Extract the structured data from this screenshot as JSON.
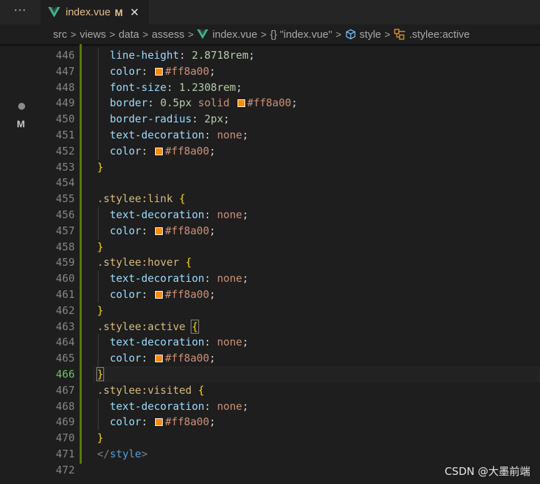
{
  "tabbar": {
    "more_label": "···",
    "tab": {
      "title": "index.vue",
      "badge": "M",
      "close": "✕"
    }
  },
  "breadcrumb": {
    "items": [
      "src",
      "views",
      "data",
      "assess",
      "index.vue",
      "{}",
      "\"index.vue\"",
      "style",
      ".stylee:active"
    ]
  },
  "gutter": {
    "modified_badge": "M"
  },
  "editor": {
    "current_line": 466,
    "lines": [
      {
        "num": "446",
        "code": [
          [
            "  ",
            "t-punc"
          ],
          [
            "line-height",
            "t-prop"
          ],
          [
            ": ",
            "t-punc"
          ],
          [
            "2.8718rem",
            "t-num"
          ],
          [
            ";",
            "t-punc"
          ]
        ]
      },
      {
        "num": "447",
        "code": [
          [
            "  ",
            "t-punc"
          ],
          [
            "color",
            "t-prop"
          ],
          [
            ": ",
            "t-punc"
          ],
          [
            "#swatch",
            "swatch"
          ],
          [
            "#ff8a00",
            "t-val"
          ],
          [
            ";",
            "t-punc"
          ]
        ]
      },
      {
        "num": "448",
        "code": [
          [
            "  ",
            "t-punc"
          ],
          [
            "font-size",
            "t-prop"
          ],
          [
            ": ",
            "t-punc"
          ],
          [
            "1.2308rem",
            "t-num"
          ],
          [
            ";",
            "t-punc"
          ]
        ]
      },
      {
        "num": "449",
        "code": [
          [
            "  ",
            "t-punc"
          ],
          [
            "border",
            "t-prop"
          ],
          [
            ": ",
            "t-punc"
          ],
          [
            "0.5px",
            "t-num"
          ],
          [
            " ",
            "t-punc"
          ],
          [
            "solid",
            "t-val"
          ],
          [
            " ",
            "t-punc"
          ],
          [
            "#swatch",
            "swatch"
          ],
          [
            "#ff8a00",
            "t-val"
          ],
          [
            ";",
            "t-punc"
          ]
        ]
      },
      {
        "num": "450",
        "code": [
          [
            "  ",
            "t-punc"
          ],
          [
            "border-radius",
            "t-prop"
          ],
          [
            ": ",
            "t-punc"
          ],
          [
            "2px",
            "t-num"
          ],
          [
            ";",
            "t-punc"
          ]
        ]
      },
      {
        "num": "451",
        "code": [
          [
            "  ",
            "t-punc"
          ],
          [
            "text-decoration",
            "t-prop"
          ],
          [
            ": ",
            "t-punc"
          ],
          [
            "none",
            "t-val"
          ],
          [
            ";",
            "t-punc"
          ]
        ]
      },
      {
        "num": "452",
        "code": [
          [
            "  ",
            "t-punc"
          ],
          [
            "color",
            "t-prop"
          ],
          [
            ": ",
            "t-punc"
          ],
          [
            "#swatch",
            "swatch"
          ],
          [
            "#ff8a00",
            "t-val"
          ],
          [
            ";",
            "t-punc"
          ]
        ]
      },
      {
        "num": "453",
        "code": [
          [
            "}",
            "t-brace"
          ]
        ]
      },
      {
        "num": "454",
        "code": []
      },
      {
        "num": "455",
        "code": [
          [
            ".stylee:link",
            "t-sel"
          ],
          [
            " ",
            "t-punc"
          ],
          [
            "{",
            "t-brace"
          ]
        ]
      },
      {
        "num": "456",
        "code": [
          [
            "  ",
            "t-punc"
          ],
          [
            "text-decoration",
            "t-prop"
          ],
          [
            ": ",
            "t-punc"
          ],
          [
            "none",
            "t-val"
          ],
          [
            ";",
            "t-punc"
          ]
        ]
      },
      {
        "num": "457",
        "code": [
          [
            "  ",
            "t-punc"
          ],
          [
            "color",
            "t-prop"
          ],
          [
            ": ",
            "t-punc"
          ],
          [
            "#swatch",
            "swatch"
          ],
          [
            "#ff8a00",
            "t-val"
          ],
          [
            ";",
            "t-punc"
          ]
        ]
      },
      {
        "num": "458",
        "code": [
          [
            "}",
            "t-brace"
          ]
        ]
      },
      {
        "num": "459",
        "code": [
          [
            ".stylee:hover",
            "t-sel"
          ],
          [
            " ",
            "t-punc"
          ],
          [
            "{",
            "t-brace"
          ]
        ]
      },
      {
        "num": "460",
        "code": [
          [
            "  ",
            "t-punc"
          ],
          [
            "text-decoration",
            "t-prop"
          ],
          [
            ": ",
            "t-punc"
          ],
          [
            "none",
            "t-val"
          ],
          [
            ";",
            "t-punc"
          ]
        ]
      },
      {
        "num": "461",
        "code": [
          [
            "  ",
            "t-punc"
          ],
          [
            "color",
            "t-prop"
          ],
          [
            ": ",
            "t-punc"
          ],
          [
            "#swatch",
            "swatch"
          ],
          [
            "#ff8a00",
            "t-val"
          ],
          [
            ";",
            "t-punc"
          ]
        ]
      },
      {
        "num": "462",
        "code": [
          [
            "}",
            "t-brace"
          ]
        ]
      },
      {
        "num": "463",
        "code": [
          [
            ".stylee:active",
            "t-sel"
          ],
          [
            " ",
            "t-punc"
          ],
          [
            "{",
            "t-brace brace-match"
          ]
        ]
      },
      {
        "num": "464",
        "code": [
          [
            "  ",
            "t-punc"
          ],
          [
            "text-decoration",
            "t-prop"
          ],
          [
            ": ",
            "t-punc"
          ],
          [
            "none",
            "t-val"
          ],
          [
            ";",
            "t-punc"
          ]
        ]
      },
      {
        "num": "465",
        "code": [
          [
            "  ",
            "t-punc"
          ],
          [
            "color",
            "t-prop"
          ],
          [
            ": ",
            "t-punc"
          ],
          [
            "#swatch",
            "swatch"
          ],
          [
            "#ff8a00",
            "t-val"
          ],
          [
            ";",
            "t-punc"
          ]
        ]
      },
      {
        "num": "466",
        "code": [
          [
            "}",
            "t-brace brace-match"
          ]
        ]
      },
      {
        "num": "467",
        "code": [
          [
            ".stylee:visited",
            "t-sel"
          ],
          [
            " ",
            "t-punc"
          ],
          [
            "{",
            "t-brace"
          ]
        ]
      },
      {
        "num": "468",
        "code": [
          [
            "  ",
            "t-punc"
          ],
          [
            "text-decoration",
            "t-prop"
          ],
          [
            ": ",
            "t-punc"
          ],
          [
            "none",
            "t-val"
          ],
          [
            ";",
            "t-punc"
          ]
        ]
      },
      {
        "num": "469",
        "code": [
          [
            "  ",
            "t-punc"
          ],
          [
            "color",
            "t-prop"
          ],
          [
            ": ",
            "t-punc"
          ],
          [
            "#swatch",
            "swatch"
          ],
          [
            "#ff8a00",
            "t-val"
          ],
          [
            ";",
            "t-punc"
          ]
        ]
      },
      {
        "num": "470",
        "code": [
          [
            "}",
            "t-brace"
          ]
        ]
      },
      {
        "num": "471",
        "code": [
          [
            "</",
            "t-tag"
          ],
          [
            "style",
            "t-tagname"
          ],
          [
            ">",
            "t-tag"
          ]
        ]
      },
      {
        "num": "472",
        "code": []
      }
    ]
  },
  "watermark": "CSDN @大墨前端",
  "colors": {
    "accent_orange": "#ff8a00",
    "git_modified": "#587c0c",
    "selector": "#d7ba7d",
    "property": "#9cdcfe",
    "value": "#ce9178",
    "number": "#b5cea8"
  }
}
